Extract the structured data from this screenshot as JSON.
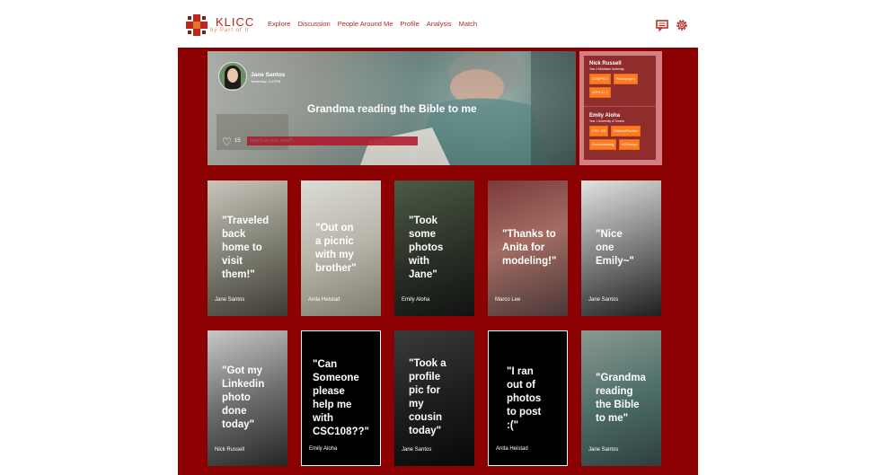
{
  "brand": {
    "name": "KLICC",
    "tagline": "by Part of It"
  },
  "nav": [
    "Explore",
    "Discussion",
    "People Around Me",
    "Profile",
    "Analysis",
    "Match"
  ],
  "icons": {
    "messages": "message-icon",
    "settings": "gear-icon"
  },
  "colors": {
    "accent": "#b3271e",
    "panel": "#8b0000",
    "tag": "#ff7a20"
  },
  "hero": {
    "user": "Jane Santos",
    "time": "Yesterday, 3:17PM",
    "title": "Grandma reading the Bible to me",
    "likes": "15",
    "placeholder": "what's on your mind?"
  },
  "matches": [
    {
      "name": "Nick Russell",
      "info": "Year 4 McMaster University",
      "tags": [
        "COMPSCI",
        "Photography",
        "cGPA 11.2"
      ]
    },
    {
      "name": "Emily Aloha",
      "info": "Year 1 University of Toronto",
      "tags": [
        "CSC 108",
        "MidtermReview",
        "Snowboarding",
        "UXDesign"
      ]
    }
  ],
  "posts": [
    {
      "quote": "\"Traveled\nback\nhome to\nvisit\nthem!\"",
      "author": "Jane Santos"
    },
    {
      "quote": "\"Out on\na picnic\nwith my\nbrother\"",
      "author": "Anila Heistad"
    },
    {
      "quote": "\"Took\nsome\nphotos\nwith\nJane\"",
      "author": "Emily Aloha"
    },
    {
      "quote": "\"Thanks to\nAnita for\nmodeling!\"",
      "author": "Marco Lee"
    },
    {
      "quote": "\"Nice\none\nEmily~\"",
      "author": "Jane Santos"
    },
    {
      "quote": "\"Got my\nLinkedin\nphoto\ndone\ntoday\"",
      "author": "Nick Russell"
    },
    {
      "quote": "\"Can\nSomeone\nplease\nhelp me\nwith\nCSC108??\"",
      "author": "Emily Aloha"
    },
    {
      "quote": "\"Took a\nprofile\npic for\nmy\ncousin\ntoday\"",
      "author": "Jane Santos"
    },
    {
      "quote": "\"I ran\nout of\nphotos\nto post\n:(\"",
      "author": "Anita Heistad"
    },
    {
      "quote": "\"Grandma\nreading\nthe Bible\nto me\"",
      "author": "Jane Santos"
    }
  ]
}
